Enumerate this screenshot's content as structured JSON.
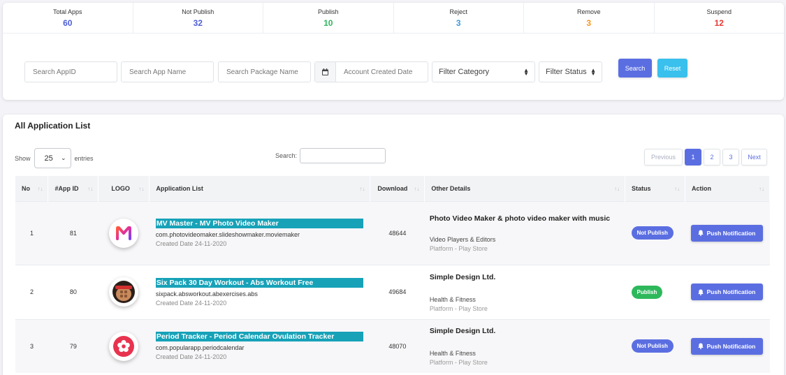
{
  "stats": [
    {
      "label": "Total Apps",
      "value": "60",
      "color": "#4e5fd8"
    },
    {
      "label": "Not Publish",
      "value": "32",
      "color": "#4e5fd8"
    },
    {
      "label": "Publish",
      "value": "10",
      "color": "#2eb85c"
    },
    {
      "label": "Reject",
      "value": "3",
      "color": "#3b9ad9"
    },
    {
      "label": "Remove",
      "value": "3",
      "color": "#f7941d"
    },
    {
      "label": "Suspend",
      "value": "12",
      "color": "#e53935"
    }
  ],
  "filters": {
    "app_id_placeholder": "Search AppID",
    "app_name_placeholder": "Search App Name",
    "package_placeholder": "Search Package Name",
    "date_placeholder": "Account Created Date",
    "category_label": "Filter Category",
    "status_label": "Filter Status",
    "search_button": "Search",
    "reset_button": "Reset",
    "search_button_color": "#5b6ee1",
    "reset_button_color": "#39c0ed"
  },
  "list": {
    "title": "All Application List",
    "show_label": "Show",
    "entries_value": "25",
    "entries_label": "entries",
    "search_label": "Search:",
    "pagination": {
      "previous": "Previous",
      "pages": [
        "1",
        "2",
        "3"
      ],
      "active": "1",
      "next": "Next"
    },
    "columns": [
      "No",
      "#App ID",
      "LOGO",
      "Application List",
      "Download",
      "Other Details",
      "Status",
      "Action"
    ],
    "rows": [
      {
        "no": "1",
        "app_id": "81",
        "name": "MV Master - MV Photo Video Maker",
        "package": "com.photovideomaker.slideshowmaker.moviemaker",
        "created": "Created Date 24-11-2020",
        "downloads": "48644",
        "details_title": "Photo Video Maker & photo video maker with music",
        "category": "Video Players & Editors",
        "platform": "Platform - Play Store",
        "status": "Not Publish",
        "status_color": "#5b6ee1",
        "action": "Push Notification"
      },
      {
        "no": "2",
        "app_id": "80",
        "name": "Six Pack 30 Day Workout - Abs Workout Free",
        "package": "sixpack.absworkout.abexercises.abs",
        "created": "Created Date 24-11-2020",
        "downloads": "49684",
        "details_title": "Simple Design Ltd.",
        "category": "Health & Fitness",
        "platform": "Platform - Play Store",
        "status": "Publish",
        "status_color": "#2eb85c",
        "action": "Push Notification"
      },
      {
        "no": "3",
        "app_id": "79",
        "name": "Period Tracker - Period Calendar Ovulation Tracker",
        "package": "com.popularapp.periodcalendar",
        "created": "Created Date 24-11-2020",
        "downloads": "48070",
        "details_title": "Simple Design Ltd.",
        "category": "Health & Fitness",
        "platform": "Platform - Play Store",
        "status": "Not Publish",
        "status_color": "#5b6ee1",
        "action": "Push Notification"
      }
    ]
  },
  "icons": {
    "calendar": "calendar-icon",
    "bell": "bell-icon",
    "sort": "sort-icon",
    "chevron": "chevron-down-icon"
  }
}
